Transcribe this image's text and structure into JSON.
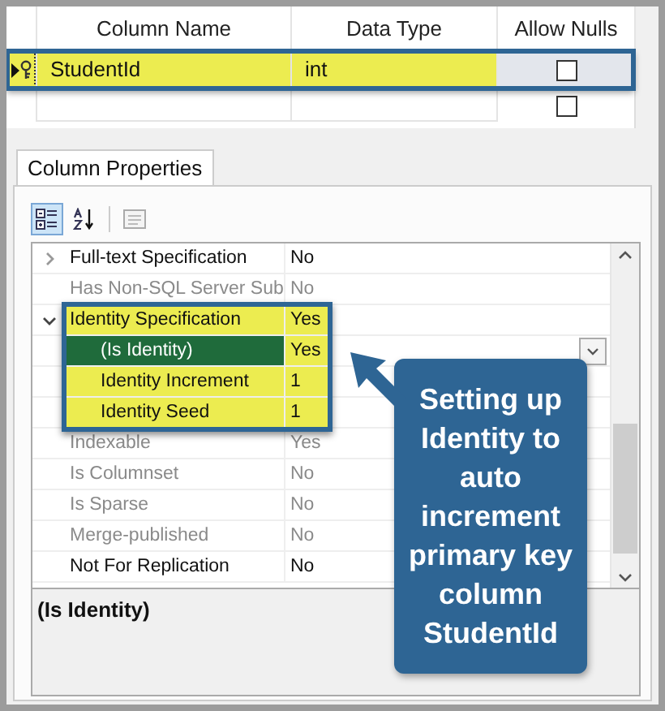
{
  "columns_grid": {
    "columns": [
      "Column Name",
      "Data Type",
      "Allow Nulls"
    ],
    "rows": [
      {
        "name": "StudentId",
        "type": "int",
        "allow_nulls": false,
        "primary_key": true,
        "selected": true,
        "highlighted": true
      },
      {
        "name": "",
        "type": "",
        "allow_nulls": false,
        "primary_key": false,
        "selected": false,
        "highlighted": false
      }
    ]
  },
  "tabs": [
    {
      "label": "Column Properties",
      "selected": true
    }
  ],
  "toolbar": {
    "categorized_selected": true
  },
  "properties": [
    {
      "label": "Full-text Specification",
      "value": "No",
      "expanded": false,
      "disabled": false,
      "selected": false
    },
    {
      "label": "Has Non-SQL Server Sub",
      "value": "No",
      "disabled": true,
      "selected": false
    },
    {
      "label": "Identity Specification",
      "value": "Yes",
      "expanded": true,
      "disabled": false,
      "selected": false,
      "highlighted": true,
      "children": [
        {
          "label": "(Is Identity)",
          "value": "Yes",
          "disabled": false,
          "selected": true
        },
        {
          "label": "Identity Increment",
          "value": "1",
          "disabled": false,
          "selected": false
        },
        {
          "label": "Identity Seed",
          "value": "1",
          "disabled": false,
          "selected": false
        }
      ]
    },
    {
      "label": "Indexable",
      "value": "Yes",
      "disabled": true,
      "selected": false
    },
    {
      "label": "Is Columnset",
      "value": "No",
      "disabled": true,
      "selected": false
    },
    {
      "label": "Is Sparse",
      "value": "No",
      "disabled": true,
      "selected": false
    },
    {
      "label": "Merge-published",
      "value": "No",
      "disabled": true,
      "selected": false
    },
    {
      "label": "Not For Replication",
      "value": "No",
      "disabled": false,
      "selected": false
    }
  ],
  "description": {
    "title": "(Is Identity)"
  },
  "callout": {
    "text": "Setting up Identity to auto increment primary key column StudentId"
  }
}
